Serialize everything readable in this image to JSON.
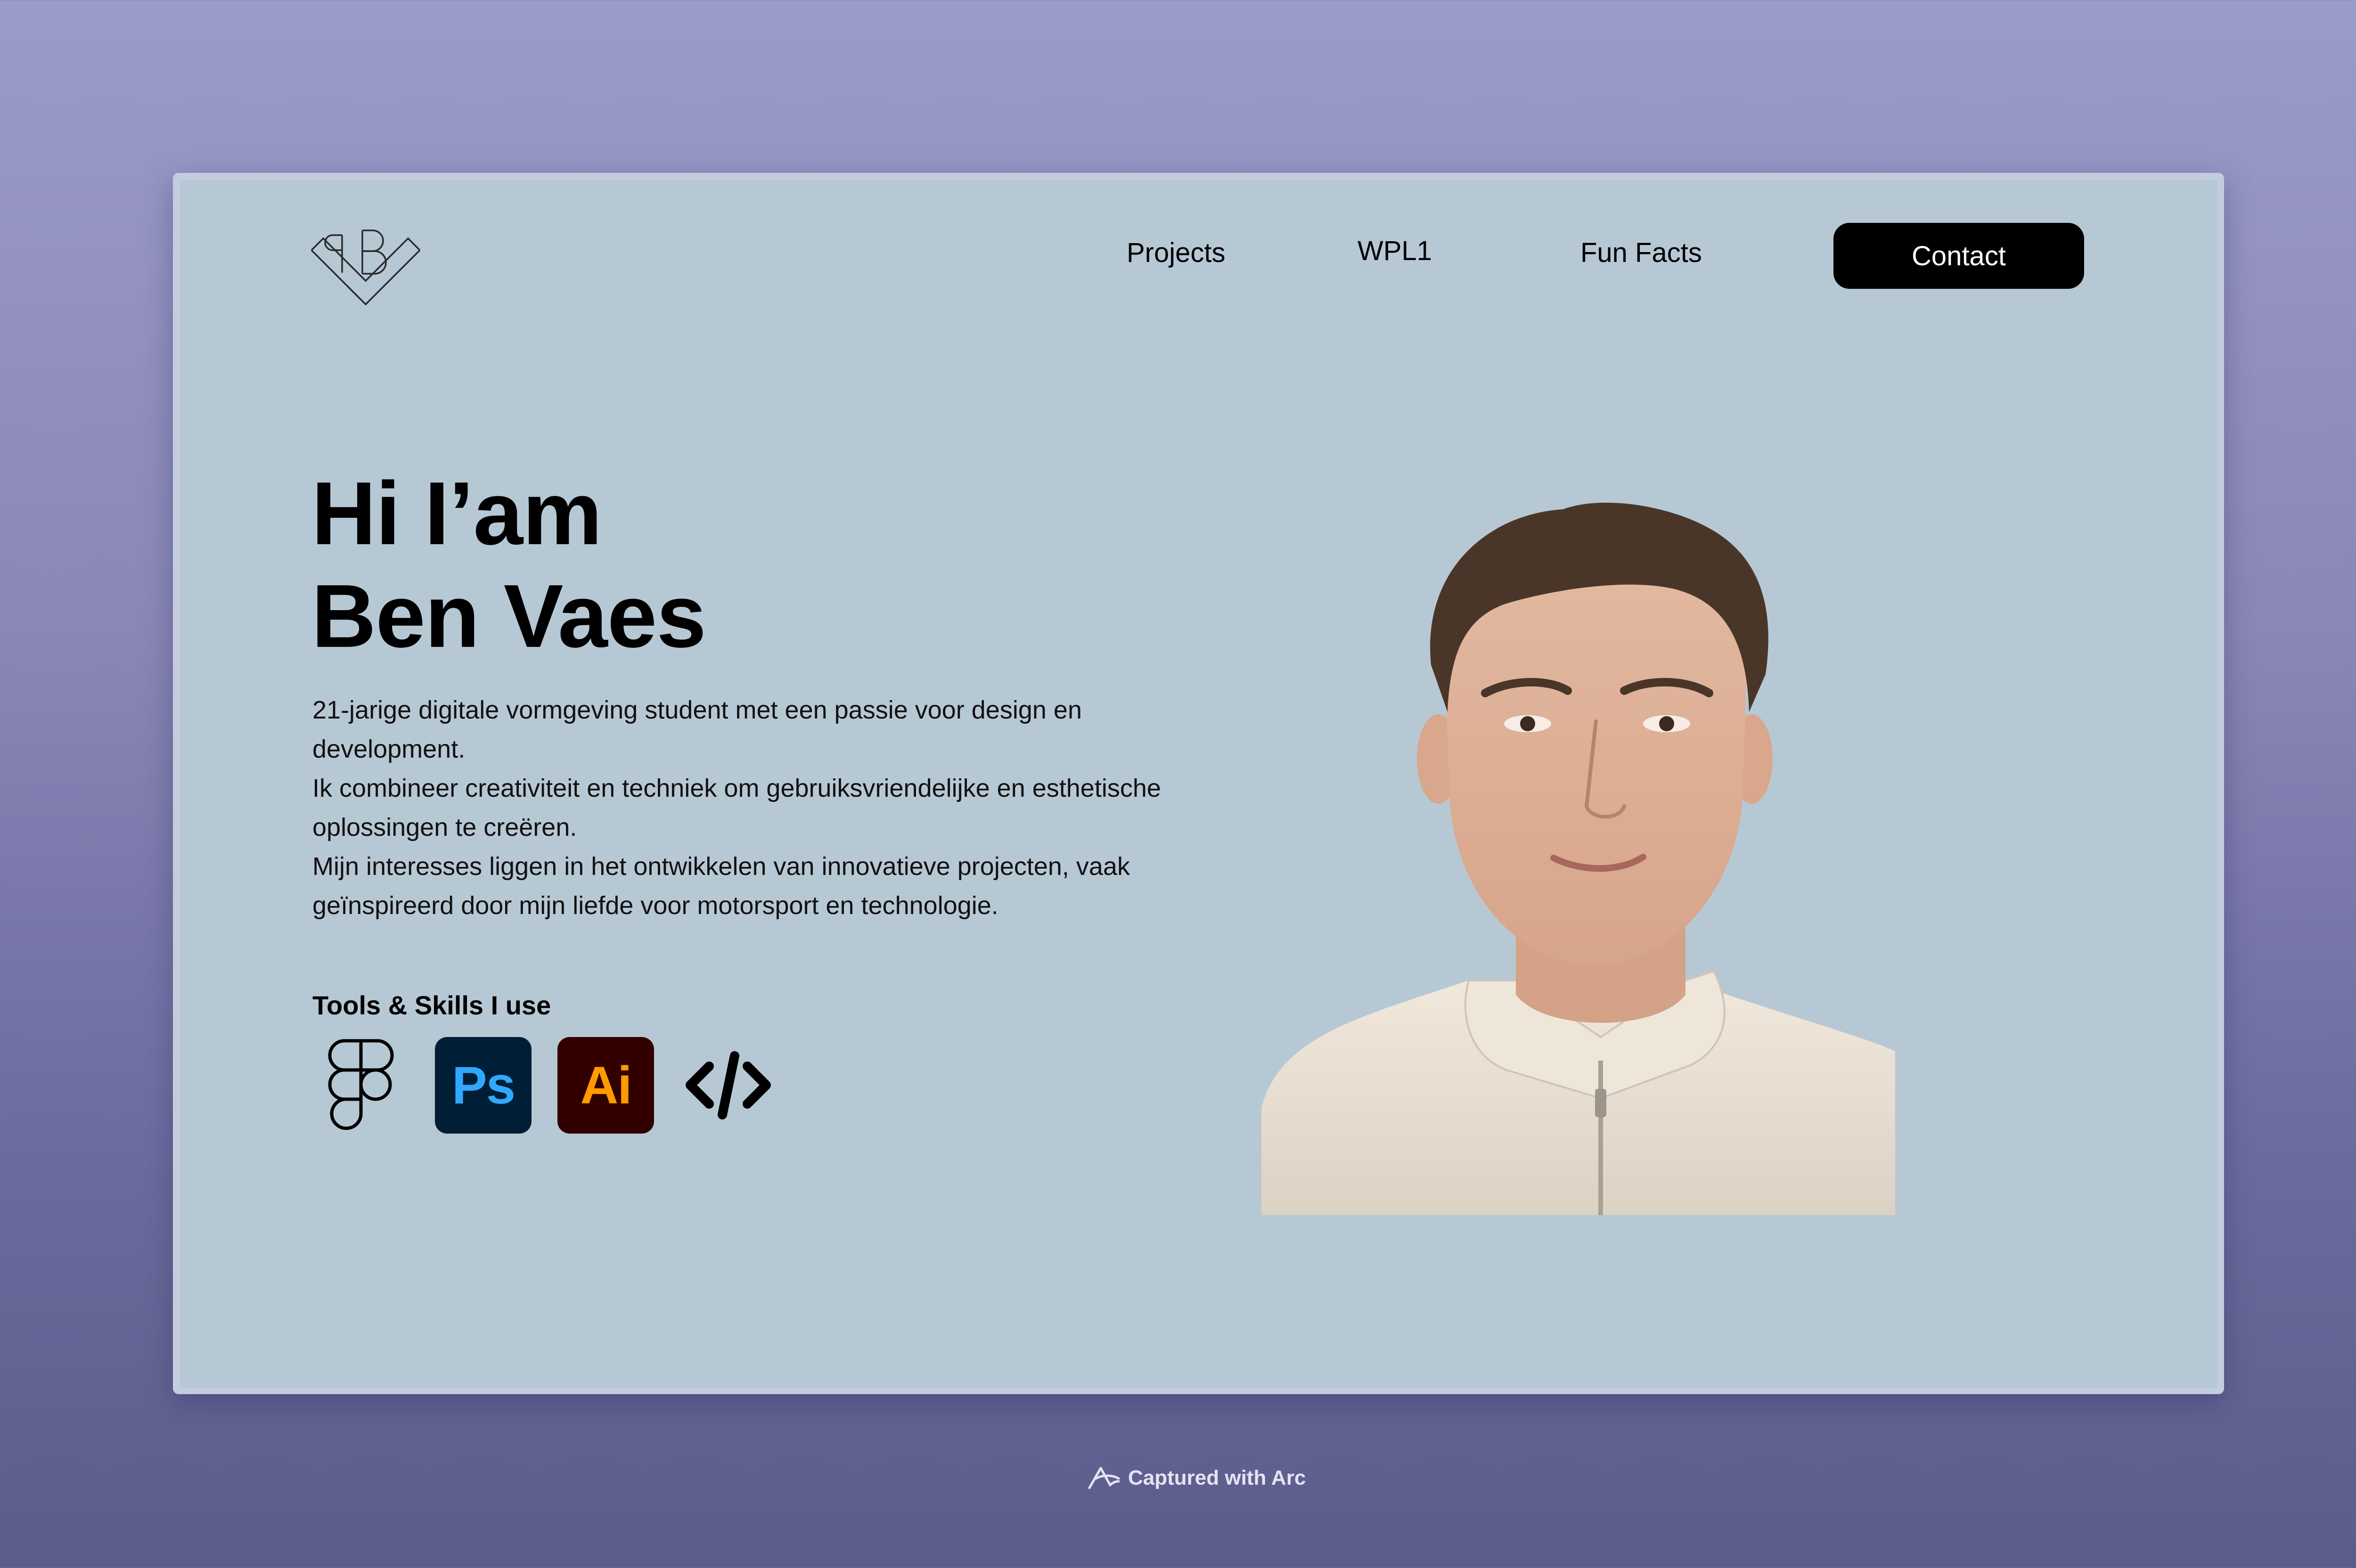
{
  "nav": {
    "logo_icon": "bv-monogram-logo",
    "links": [
      "Projects",
      "WPL1",
      "Fun Facts"
    ],
    "contact_label": "Contact"
  },
  "hero": {
    "title_line1": "Hi I’am",
    "title_line2": "Ben Vaes",
    "bio": [
      "21-jarige digitale vormgeving student met een passie voor design en development.",
      "Ik combineer creativiteit en techniek om gebruiksvriendelijke en esthetische oplossingen te creëren.",
      "Mijn interesses liggen in het ontwikkelen van innovatieve projecten, vaak geïnspireerd door mijn liefde voor motorsport en technologie."
    ]
  },
  "tools": {
    "heading": "Tools & Skills I use",
    "items": [
      {
        "icon": "figma-icon"
      },
      {
        "icon": "photoshop-icon",
        "label": "Ps"
      },
      {
        "icon": "illustrator-icon",
        "label": "Ai"
      },
      {
        "icon": "code-icon"
      }
    ]
  },
  "colors": {
    "page_background": "#b7c8d5",
    "contact_button": "#000000",
    "photoshop_bg": "#001e36",
    "photoshop_fg": "#31a8ff",
    "illustrator_bg": "#330000",
    "illustrator_fg": "#ff9a00"
  },
  "footer": {
    "arc_icon": "arc-logo-icon",
    "caption": "Captured with Arc"
  }
}
